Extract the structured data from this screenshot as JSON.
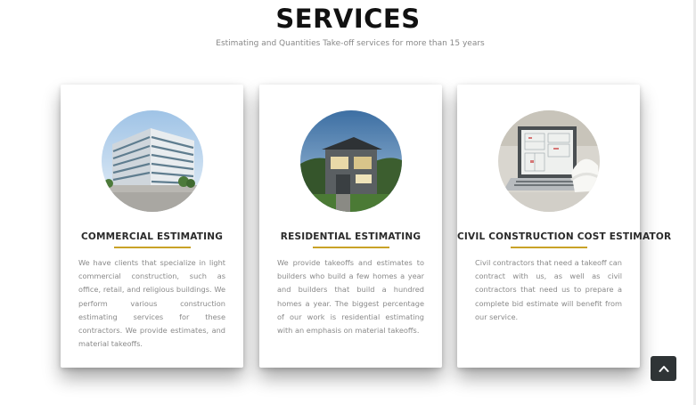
{
  "header": {
    "title": "SERVICES",
    "subtitle": "Estimating and Quantities Take-off services for more than 15 years"
  },
  "cards": [
    {
      "image": "commercial-building-image",
      "title": "COMMERCIAL ESTIMATING",
      "text": "We have clients that specialize in light commercial construction, such as office, retail, and religious buildings. We perform various construction estimating services for these contractors. We provide estimates, and material takeoffs."
    },
    {
      "image": "residential-house-image",
      "title": "RESIDENTIAL ESTIMATING",
      "text": "We provide takeoffs and estimates to builders who build a few homes a year and builders that build a hundred homes a year. The biggest percentage of our work is residential estimating with an emphasis on material takeoffs."
    },
    {
      "image": "laptop-blueprint-hardhat-image",
      "title": "CIVIL CONSTRUCTION COST ESTIMATOR",
      "text": "Civil contractors that need a takeoff can contract with us, as well as civil contractors that need us to prepare a complete bid estimate will benefit from our service."
    }
  ],
  "scroll_top": {
    "icon": "chevron-up-icon"
  },
  "colors": {
    "accent_rule": "#c9a227",
    "scroll_button": "#2f3436",
    "body_text": "#8a8a8a"
  }
}
